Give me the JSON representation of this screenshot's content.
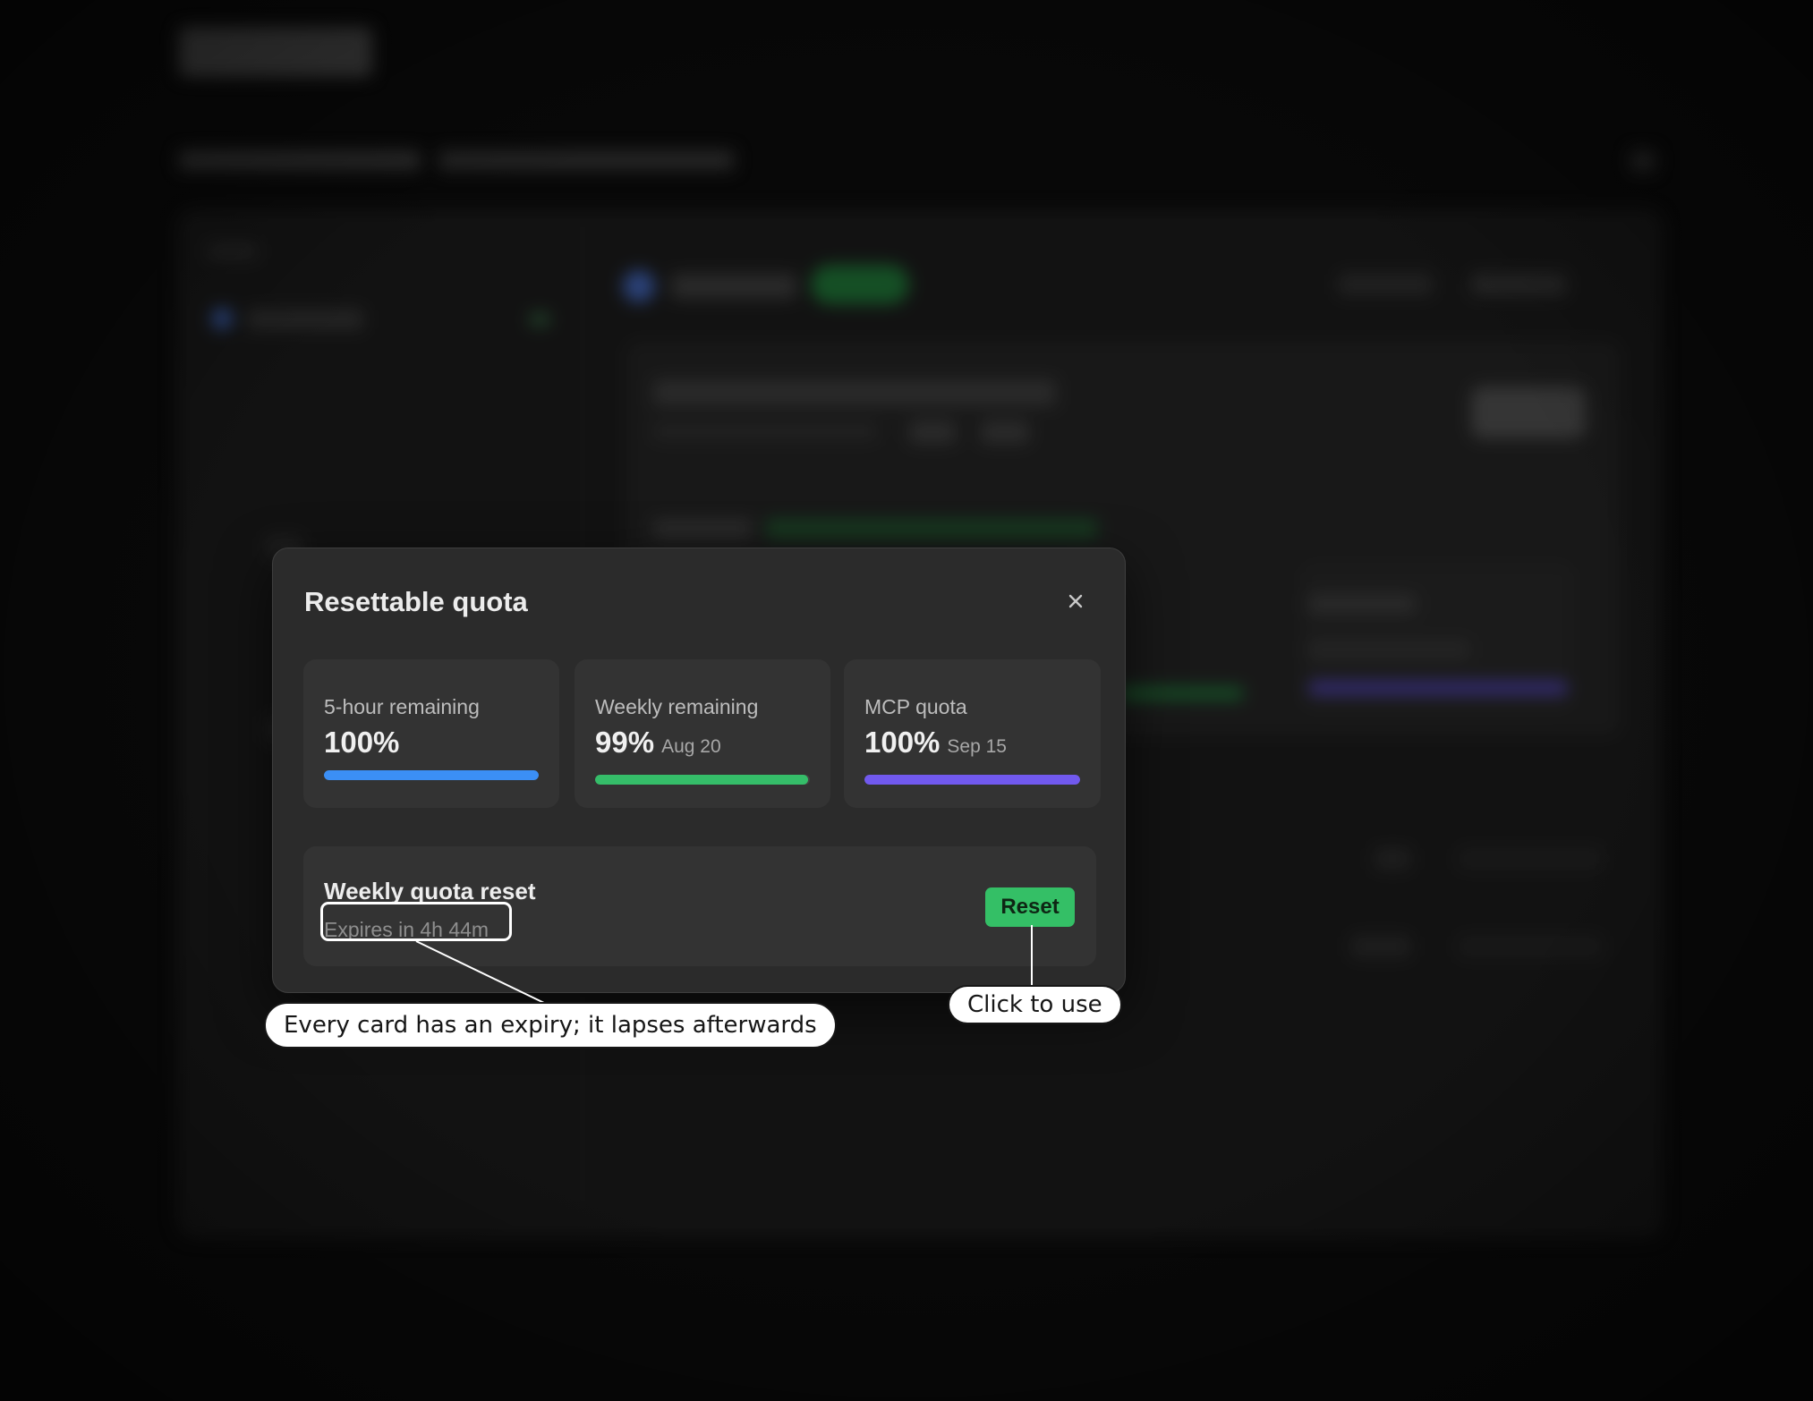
{
  "modal": {
    "title": "Resettable quota",
    "close_icon": "close-icon"
  },
  "quota_cards": [
    {
      "label": "5-hour remaining",
      "value": "100%",
      "date": "",
      "progress_percent": 100,
      "color": "#3b8ff5"
    },
    {
      "label": "Weekly remaining",
      "value": "99%",
      "date": "Aug 20",
      "progress_percent": 99,
      "color": "#35bd69"
    },
    {
      "label": "MCP quota",
      "value": "100%",
      "date": "Sep 15",
      "progress_percent": 100,
      "color": "#7159ee"
    }
  ],
  "reset_card": {
    "title": "Weekly quota reset",
    "expiry": "Expires in 4h 44m",
    "button_label": "Reset",
    "button_color": "#34bf66"
  },
  "annotations": {
    "expiry_note": "Every card has an expiry; it lapses afterwards",
    "reset_note": "Click to use"
  }
}
